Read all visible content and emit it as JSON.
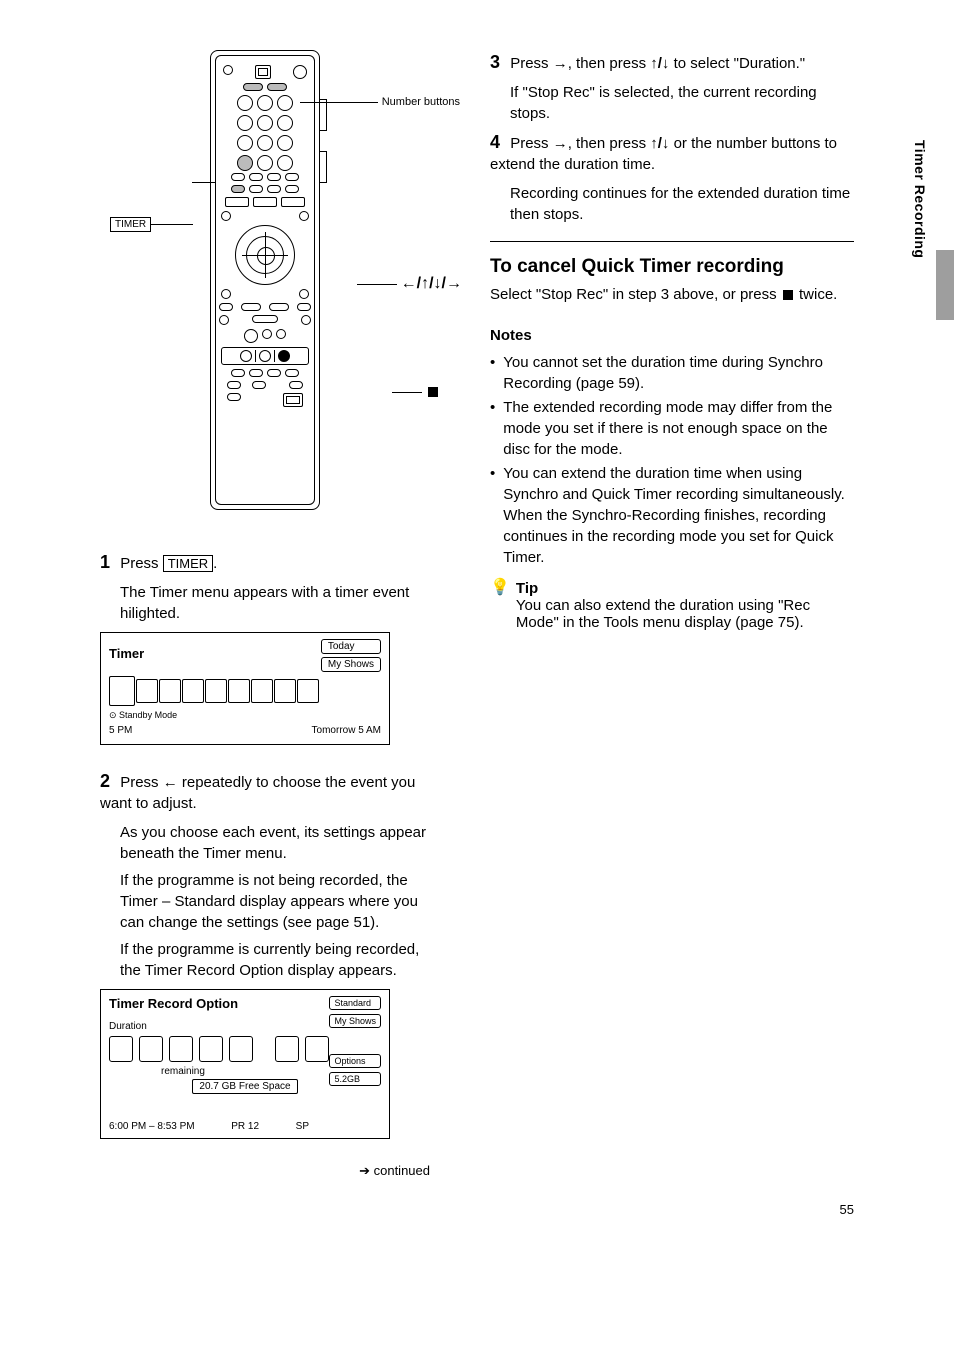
{
  "remote_labels": {
    "top_right": "Number buttons",
    "timer": "TIMER",
    "dpad": "←/↑/↓/→",
    "stop": "■"
  },
  "menu1": {
    "title": "Timer",
    "tab_today": "Today",
    "tab_shows": "My Shows",
    "standby_marker": "⊙ Standby Mode",
    "scale_left": "5 PM",
    "scale_right": "Tomorrow 5 AM"
  },
  "left_steps": {
    "s1": "Press",
    "s1_after_box": ".",
    "s1_box": "TIMER",
    "s1_menu_text": "The Timer menu appears with a timer event hilighted.",
    "s2_a": "Press ",
    "s2_b": " repeatedly to choose the event you want to adjust.",
    "s2_detail1": "As you choose each event, its settings appear beneath the Timer menu.",
    "s2_detail2": "If the programme is not being recorded, the Timer – Standard display appears where you can change the settings (see page 51).",
    "s2_detail3": "If the programme is currently being recorded, the Timer Record Option display appears.",
    "continued_from": "➔ continued"
  },
  "menu2": {
    "title": "Timer Record Option",
    "tab_standard": "Standard",
    "tab_shows": "My Shows",
    "tab_options": "Options",
    "free": "5.2GB",
    "duration": "Duration",
    "space": "20.7 GB Free Space",
    "time_range": "6:00 PM – 8:53 PM",
    "channel": "PR 12",
    "mode": "SP",
    "remain": "remaining"
  },
  "right": {
    "s3_a": "Press ",
    "s3_b": ", then press ",
    "s3_c": " to select \"Duration.\"",
    "s3_detail1": "If \"Stop Rec\" is selected, the current recording stops.",
    "s4_a": "Press ",
    "s4_b": ", then press ",
    "s4_c": " or the number buttons to extend the duration time.",
    "s4_d": "Recording continues for the extended duration time then stops.",
    "section_title": "To cancel Quick Timer recording",
    "section_body_a": "Select \"Stop Rec\" in step 3 above, or press ",
    "section_body_b": " twice.",
    "notes_label": "Notes",
    "note1": "You cannot set the duration time during Synchro Recording (page 59).",
    "note2": "The extended recording mode may differ from the mode you set if there is not enough space on the disc for the mode.",
    "note3": "You can extend the duration time when using Synchro and Quick Timer recording simultaneously. When the Synchro-Recording finishes, recording continues in the recording mode you set for Quick Timer.",
    "tip_label": "Tip",
    "tip_text": "You can also extend the duration using \"Rec Mode\" in the Tools menu display (page 75)."
  },
  "side_tab_text": "Timer Recording",
  "footer": {
    "page": "55"
  }
}
